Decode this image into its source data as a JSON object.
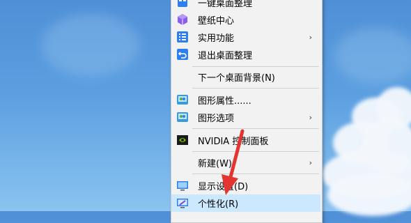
{
  "menu": {
    "items": [
      {
        "label": "一键桌面整理",
        "icon": "desktop-organize-icon",
        "arrow": ""
      },
      {
        "label": "壁纸中心",
        "icon": "wallpaper-cube-icon",
        "arrow": ""
      },
      {
        "label": "实用功能",
        "icon": "list-icon",
        "arrow": "›"
      },
      {
        "label": "退出桌面整理",
        "icon": "exit-back-icon",
        "arrow": ""
      },
      {
        "label": "下一个桌面背景(N)",
        "icon": "",
        "arrow": ""
      },
      {
        "label": "图形属性......",
        "icon": "intel-graphics-icon",
        "arrow": ""
      },
      {
        "label": "图形选项",
        "icon": "intel-graphics-icon",
        "arrow": "›"
      },
      {
        "label": "NVIDIA 控制面板",
        "icon": "nvidia-icon",
        "arrow": ""
      },
      {
        "label": "新建(W)",
        "icon": "",
        "arrow": "›"
      },
      {
        "label": "显示设置(D)",
        "icon": "display-settings-icon",
        "arrow": ""
      },
      {
        "label": "个性化(R)",
        "icon": "personalize-icon",
        "arrow": ""
      }
    ]
  },
  "colors": {
    "menu_bg": "#f2f2f2",
    "highlight": "#cce8ff",
    "pointer": "#e3342f",
    "desktop_top": "#4f8fd6",
    "desktop_bottom": "#8cc3ef"
  }
}
